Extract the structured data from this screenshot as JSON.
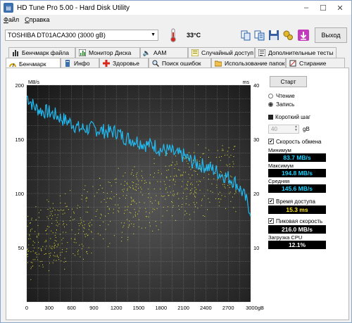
{
  "window": {
    "title": "HD Tune Pro 5.00 - Hard Disk Utility"
  },
  "menu": [
    "Файл",
    "Справка"
  ],
  "toolbar": {
    "drive": "TOSHIBA DT01ACA300 (3000 gB)",
    "temperature": "33°C",
    "exit_label": "Выход"
  },
  "tabs_top": [
    "Бенчмарк файла",
    "Монитор Диска",
    "AAM",
    "Случайный доступ",
    "Дополнительные тесты"
  ],
  "tabs_bottom": [
    "Бенчмарк",
    "Инфо",
    "Здоровье",
    "Поиск ошибок",
    "Использование папок",
    "Стирание"
  ],
  "side": {
    "start_label": "Старт",
    "read_label": "Чтение",
    "write_label": "Запись",
    "short_step_label": "Короткий шаг",
    "step_value": "40",
    "step_unit": "gB",
    "transfer_rate_label": "Скорость обмена",
    "min_label": "Минимум",
    "min_value": "83.7 MB/s",
    "max_label": "Максимум",
    "max_value": "194.8 MB/s",
    "avg_label": "Средняя",
    "avg_value": "145.6 MB/s",
    "access_time_label": "Время доступа",
    "access_time_value": "15.3 ms",
    "burst_rate_label": "Пиковая скорость",
    "burst_rate_value": "216.0 MB/s",
    "cpu_label": "Загрузка CPU",
    "cpu_value": "12.1%"
  },
  "chart_data": {
    "type": "line",
    "y_left_label": "MB/s",
    "y_right_label": "ms",
    "y_left_ticks": [
      "200",
      "150",
      "100",
      "50"
    ],
    "y_right_ticks": [
      "40",
      "30",
      "20",
      "10"
    ],
    "x_ticks": [
      "0",
      "300",
      "600",
      "900",
      "1200",
      "1500",
      "1800",
      "2100",
      "2400",
      "2700",
      "3000gB"
    ],
    "xlim": [
      0,
      3000
    ],
    "ylim_left": [
      0,
      200
    ],
    "ylim_right": [
      0,
      40
    ],
    "grid": true,
    "series": [
      {
        "color": "#21b9f0",
        "x": [
          0,
          100,
          200,
          300,
          400,
          500,
          600,
          700,
          800,
          900,
          1000,
          1100,
          1200,
          1300,
          1400,
          1500,
          1600,
          1700,
          1800,
          1900,
          2000,
          2100,
          2200,
          2300,
          2400,
          2500,
          2600,
          2700,
          2800,
          2900,
          3000
        ],
        "values": [
          190,
          180,
          176,
          175,
          172,
          168,
          165,
          160,
          160,
          160,
          158,
          157,
          157,
          152,
          150,
          148,
          145,
          145,
          140,
          140,
          136,
          135,
          130,
          127,
          125,
          122,
          118,
          115,
          110,
          100,
          84
        ]
      },
      {
        "color": "#e8e830",
        "type": "scatter",
        "axis": "right",
        "x": [
          0,
          100,
          200,
          300,
          400,
          500,
          600,
          700,
          800,
          900,
          1000,
          1100,
          1200,
          1300,
          1400,
          1500,
          1600,
          1700,
          1800,
          1900,
          2000,
          2100,
          2200,
          2300,
          2400,
          2500,
          2600,
          2700,
          2800
        ],
        "values": [
          10,
          11,
          12,
          12.5,
          13,
          13.5,
          14,
          14.5,
          15,
          16,
          16.5,
          17,
          17.5,
          18,
          18.5,
          19,
          19.5,
          20,
          20.5,
          21,
          21.5,
          22,
          22,
          22.5,
          23,
          23,
          23.5,
          23.5,
          24
        ]
      }
    ]
  },
  "colors": {
    "chart_bg_center": "#4e4e4e",
    "chart_bg_edge": "#1a1a1a",
    "grid": "#8a8a8a",
    "read_line": "#21b9f0",
    "access_dots": "#e8e830"
  }
}
